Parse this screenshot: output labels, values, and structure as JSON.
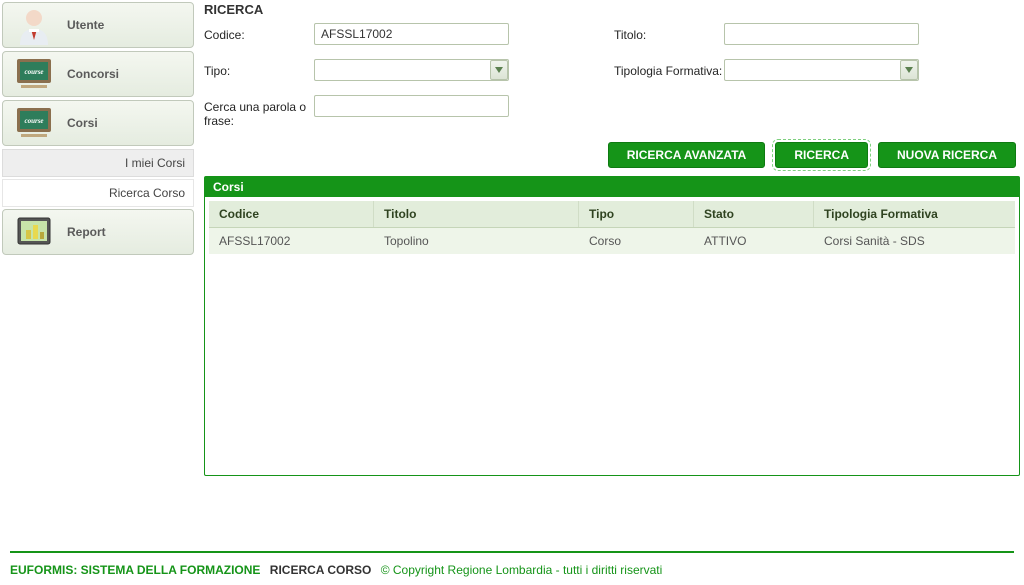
{
  "sidebar": {
    "items": [
      {
        "label": "Utente"
      },
      {
        "label": "Concorsi"
      },
      {
        "label": "Corsi"
      }
    ],
    "subitems": [
      {
        "label": "I miei Corsi"
      },
      {
        "label": "Ricerca Corso"
      }
    ],
    "lastItem": {
      "label": "Report"
    }
  },
  "search": {
    "heading": "RICERCA",
    "labels": {
      "codice": "Codice:",
      "titolo": "Titolo:",
      "tipo": "Tipo:",
      "tipologia": "Tipologia Formativa:",
      "frase": "Cerca una parola o frase:"
    },
    "values": {
      "codice": "AFSSL17002",
      "titolo": "",
      "tipo": "",
      "tipologia": "",
      "frase": ""
    },
    "buttons": {
      "advanced": "RICERCA AVANZATA",
      "search": "RICERCA",
      "new": "NUOVA RICERCA"
    }
  },
  "results": {
    "panelTitle": "Corsi",
    "headers": [
      "Codice",
      "Titolo",
      "Tipo",
      "Stato",
      "Tipologia Formativa"
    ],
    "rows": [
      {
        "codice": "AFSSL17002",
        "titolo": "Topolino",
        "tipo": "Corso",
        "stato": "ATTIVO",
        "tipologia": "Corsi Sanità - SDS"
      }
    ]
  },
  "footer": {
    "system": "EUFORMIS: SISTEMA DELLA FORMAZIONE",
    "page": "RICERCA CORSO",
    "copyright": "© Copyright Regione Lombardia - tutti i diritti riservati"
  }
}
